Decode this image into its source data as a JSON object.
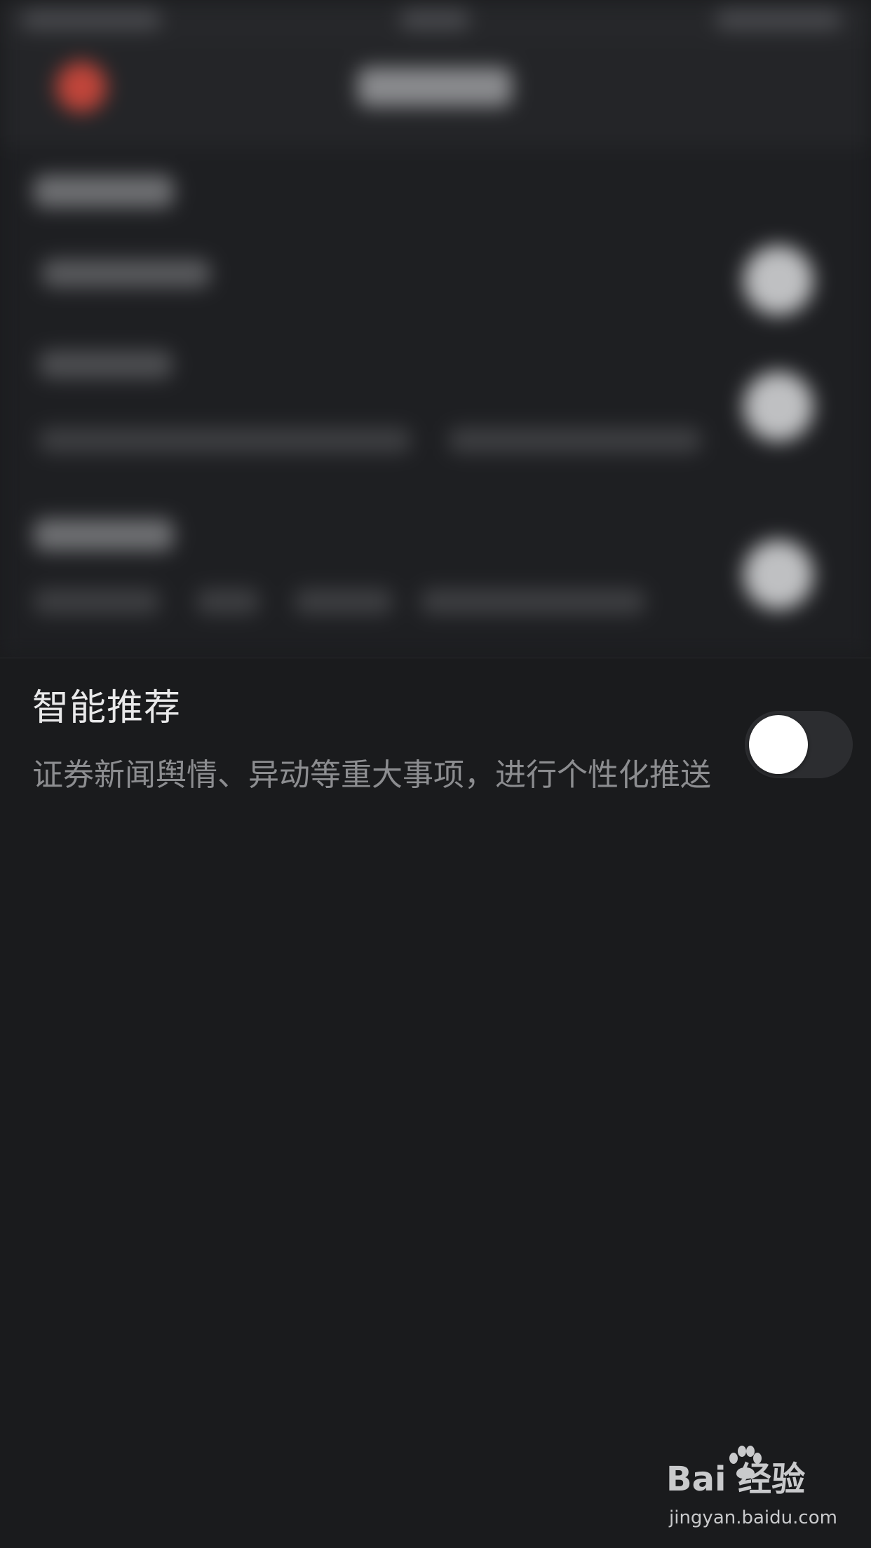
{
  "settings": {
    "smart_recommend": {
      "title": "智能推荐",
      "description": "证券新闻舆情、异动等重大事项，进行个性化推送",
      "enabled": false
    }
  },
  "watermark": {
    "logo_text": "Bai  经验",
    "url": "jingyan.baidu.com"
  },
  "colors": {
    "background": "#1a1b1d",
    "toggle_off_track": "#2c2d30",
    "toggle_knob": "#ffffff",
    "title_text": "#e9e9ea",
    "desc_text": "#8c8d90",
    "back_button_accent": "#c0453a"
  },
  "icons": {
    "back": "back-icon",
    "watermark_paw": "paw-icon"
  }
}
